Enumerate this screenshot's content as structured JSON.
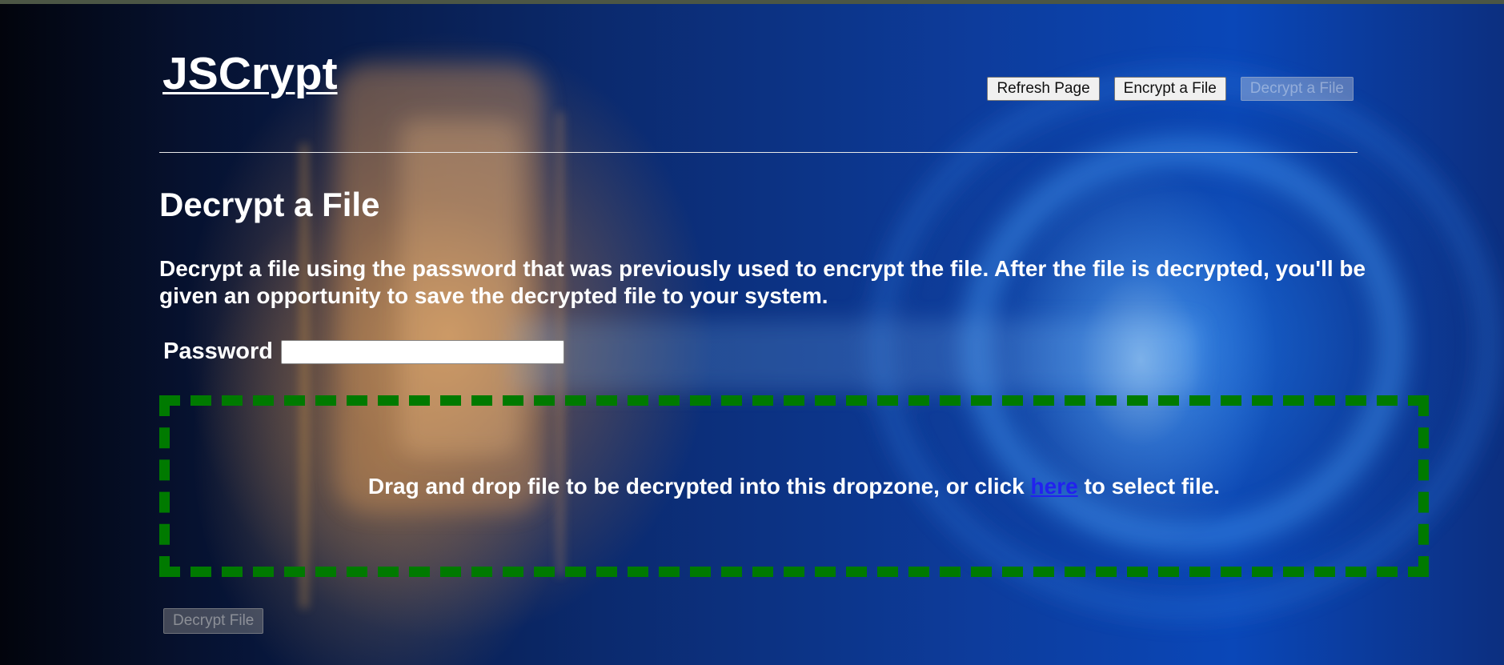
{
  "app": {
    "logo_text": "JSCrypt"
  },
  "nav": {
    "refresh_label": "Refresh Page",
    "encrypt_label": "Encrypt a File",
    "decrypt_label": "Decrypt a File"
  },
  "main": {
    "title": "Decrypt a File",
    "description": "Decrypt a file using the password that was previously used to encrypt the file. After the file is decrypted, you'll be given an opportunity to save the decrypted file to your system.",
    "password_label": "Password",
    "password_value": "",
    "dropzone": {
      "text_before": "Drag and drop file to be decrypted into this dropzone, or click ",
      "link_text": "here",
      "text_after": " to select file."
    },
    "submit_label": "Decrypt File"
  },
  "colors": {
    "dropzone_border": "#007a00",
    "link": "#2222ee",
    "text": "#ffffff"
  }
}
